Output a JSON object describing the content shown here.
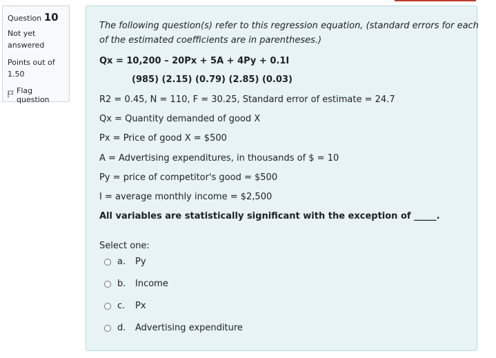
{
  "question_info": {
    "question_label": "Question",
    "question_number": "10",
    "state_line1": "Not yet",
    "state_line2": "answered",
    "grade_line1": "Points out of",
    "grade_line2": "1.50",
    "flag_label": "Flag question"
  },
  "question": {
    "intro_line1": "The following question(s) refer to this regression equation, (standard errors for each",
    "intro_line2": "of the estimated coefficients are in parentheses.)",
    "equation": "Qx = 10,200 – 20Px + 5A + 4Py + 0.1I",
    "standard_errors": "(985) (2.15) (0.79) (2.85) (0.03)",
    "stats": "R2 = 0.45, N = 110, F = 30.25, Standard error of estimate = 24.7",
    "def_qx": "Qx = Quantity demanded of good X",
    "def_px": "Px = Price of good X = $500",
    "def_a": "A = Advertising expenditures, in thousands of $ = 10",
    "def_py": "Py = price of competitor's good = $500",
    "def_i": "I = average monthly income = $2,500",
    "prompt": "All variables are statistically significant with the exception of _____."
  },
  "answer": {
    "select_label": "Select one:",
    "options": [
      {
        "letter": "a.",
        "text": "Py"
      },
      {
        "letter": "b.",
        "text": "Income"
      },
      {
        "letter": "c.",
        "text": "Px"
      },
      {
        "letter": "d.",
        "text": "Advertising expenditure"
      }
    ]
  },
  "colors": {
    "content_bg": "#e7f3f5",
    "content_border": "#b8dce2",
    "info_bg": "#f8f9fa",
    "accent": "#c0392b"
  }
}
